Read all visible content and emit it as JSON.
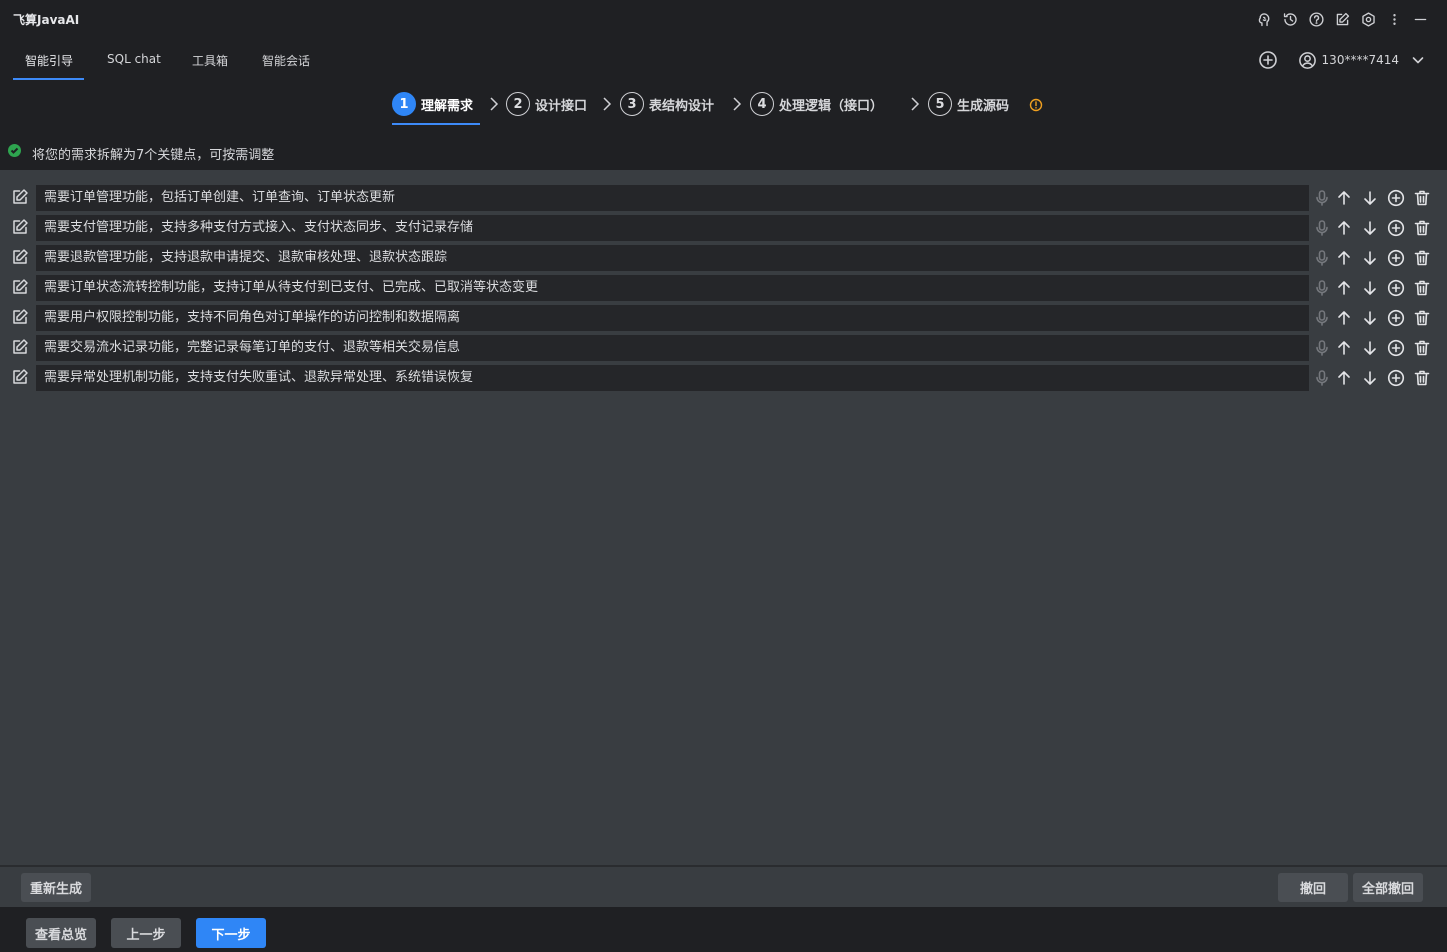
{
  "app": {
    "title": "飞算JavaAI"
  },
  "header_icons": [
    "brain-icon",
    "history-icon",
    "help-icon",
    "edit-icon",
    "settings-icon",
    "more-icon",
    "minimize-icon"
  ],
  "tabs": [
    {
      "label": "智能引导",
      "active": true
    },
    {
      "label": "SQL chat",
      "active": false
    },
    {
      "label": "工具箱",
      "active": false
    },
    {
      "label": "智能会话",
      "active": false
    }
  ],
  "user": {
    "label": "130****7414"
  },
  "steps": [
    {
      "num": "1",
      "label": "理解需求",
      "active": true
    },
    {
      "num": "2",
      "label": "设计接口",
      "active": false
    },
    {
      "num": "3",
      "label": "表结构设计",
      "active": false
    },
    {
      "num": "4",
      "label": "处理逻辑（接口）",
      "active": false
    },
    {
      "num": "5",
      "label": "生成源码",
      "active": false
    }
  ],
  "status": {
    "text": "将您的需求拆解为7个关键点，可按需调整",
    "color": "#2ea44f"
  },
  "requirements": [
    "需要订单管理功能，包括订单创建、订单查询、订单状态更新",
    "需要支付管理功能，支持多种支付方式接入、支付状态同步、支付记录存储",
    "需要退款管理功能，支持退款申请提交、退款审核处理、退款状态跟踪",
    "需要订单状态流转控制功能，支持订单从待支付到已支付、已完成、已取消等状态变更",
    "需要用户权限控制功能，支持不同角色对订单操作的访问控制和数据隔离",
    "需要交易流水记录功能，完整记录每笔订单的支付、退款等相关交易信息",
    "需要异常处理机制功能，支持支付失败重试、退款异常处理、系统错误恢复"
  ],
  "lower_buttons": {
    "regenerate": "重新生成",
    "undo": "撤回",
    "undo_all": "全部撤回"
  },
  "footer_buttons": {
    "overview": "查看总览",
    "prev": "上一步",
    "next": "下一步"
  },
  "colors": {
    "accent": "#2f86f6",
    "warning": "#f0a020"
  }
}
